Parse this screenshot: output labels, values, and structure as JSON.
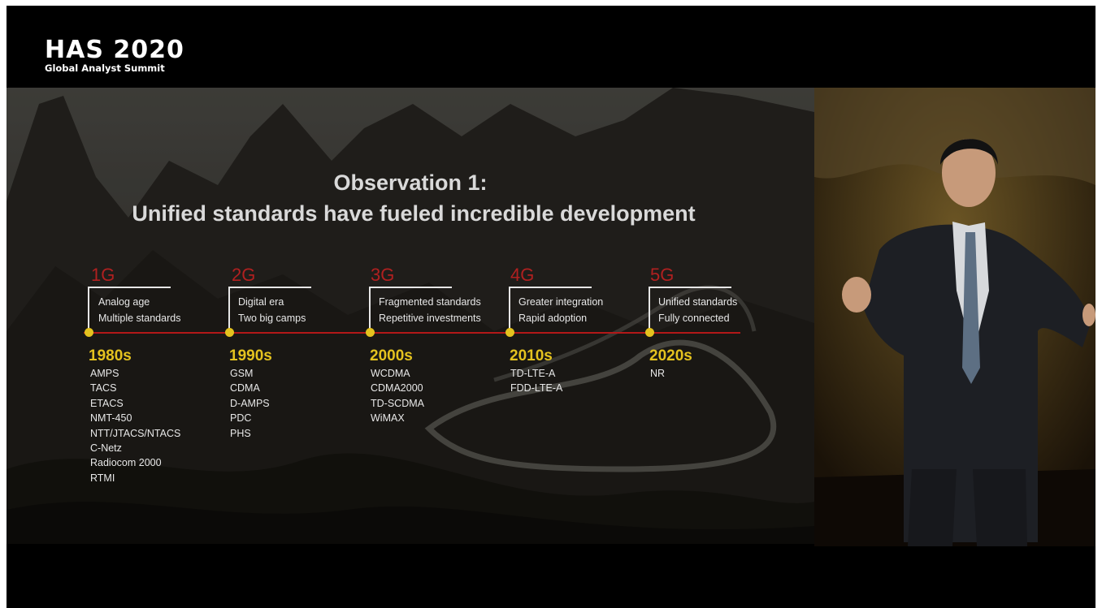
{
  "event": {
    "title": "HAS 2020",
    "subtitle": "Global Analyst Summit"
  },
  "slide": {
    "title_line1": "Observation 1:",
    "title_line2": "Unified standards have fueled incredible development",
    "generations": [
      {
        "gen": "1G",
        "desc": [
          "Analog age",
          "Multiple standards"
        ],
        "decade": "1980s",
        "standards": [
          "AMPS",
          "TACS",
          "ETACS",
          "NMT-450",
          "NTT/JTACS/NTACS",
          "C-Netz",
          "Radiocom 2000",
          "RTMI"
        ]
      },
      {
        "gen": "2G",
        "desc": [
          "Digital era",
          "Two big camps"
        ],
        "decade": "1990s",
        "standards": [
          "GSM",
          "CDMA",
          "D-AMPS",
          "PDC",
          "PHS"
        ]
      },
      {
        "gen": "3G",
        "desc": [
          "Fragmented standards",
          "Repetitive investments"
        ],
        "decade": "2000s",
        "standards": [
          "WCDMA",
          "CDMA2000",
          "TD-SCDMA",
          "WiMAX"
        ]
      },
      {
        "gen": "4G",
        "desc": [
          "Greater integration",
          "Rapid adoption"
        ],
        "decade": "2010s",
        "standards": [
          "TD-LTE-A",
          "FDD-LTE-A"
        ]
      },
      {
        "gen": "5G",
        "desc": [
          "Unified standards",
          "Fully connected"
        ],
        "decade": "2020s",
        "standards": [
          "NR"
        ]
      }
    ],
    "colors": {
      "generation_label": "#b02020",
      "timeline": "#b31818",
      "decade": "#e4c21f",
      "text": "#e8e8e8"
    }
  }
}
